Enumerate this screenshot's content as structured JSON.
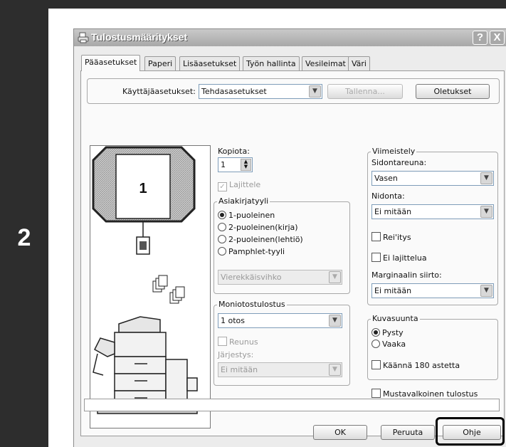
{
  "step": {
    "number": "2"
  },
  "window": {
    "title": "Tulostusmääritykset",
    "help_btn": "?",
    "close_btn": "X"
  },
  "tabs": [
    {
      "label": "Pääasetukset",
      "active": true
    },
    {
      "label": "Paperi",
      "active": false
    },
    {
      "label": "Lisäasetukset",
      "active": false
    },
    {
      "label": "Työn hallinta",
      "active": false
    },
    {
      "label": "Vesileimat",
      "active": false
    },
    {
      "label": "Väri",
      "active": false
    }
  ],
  "user_settings": {
    "label": "Käyttäjäasetukset:",
    "value": "Tehdasasetukset",
    "save_button": "Tallenna...",
    "defaults_button": "Oletukset"
  },
  "preview": {
    "page_number": "1"
  },
  "copies": {
    "label": "Kopiota:",
    "value": "1",
    "collate_label": "Lajittele",
    "collate_checked": true
  },
  "document_style": {
    "legend": "Asiakirjatyyli",
    "options": [
      "1-puoleinen",
      "2-puoleinen(kirja)",
      "2-puoleinen(lehtiö)",
      "Pamphlet-tyyli"
    ],
    "selected": 0,
    "pamphlet_combo": "Vierekkäisvihko"
  },
  "nup": {
    "legend": "Moniotostulostus",
    "value": "1 otos",
    "border_label": "Reunus",
    "order_label": "Järjestys:",
    "order_value": "Ei mitään"
  },
  "finishing": {
    "legend": "Viimeistely",
    "binding_edge_label": "Sidontareuna:",
    "binding_edge_value": "Vasen",
    "staple_label": "Nidonta:",
    "staple_value": "Ei mitään",
    "punch_label": "Rei'itys",
    "no_offset_label": "Ei lajittelua",
    "margin_shift_label": "Marginaalin siirto:",
    "margin_shift_value": "Ei mitään"
  },
  "orientation": {
    "legend": "Kuvasuunta",
    "options": [
      "Pysty",
      "Vaaka"
    ],
    "selected": 0,
    "rotate_label": "Käännä 180 astetta"
  },
  "bw_print_label": "Mustavalkoinen tulostus",
  "buttons": {
    "ok": "OK",
    "cancel": "Peruuta",
    "help": "Ohje"
  },
  "colors": {
    "step_bar": "#2d2d2d",
    "title_bar": "#a8a8a8",
    "highlight": "#000000"
  }
}
